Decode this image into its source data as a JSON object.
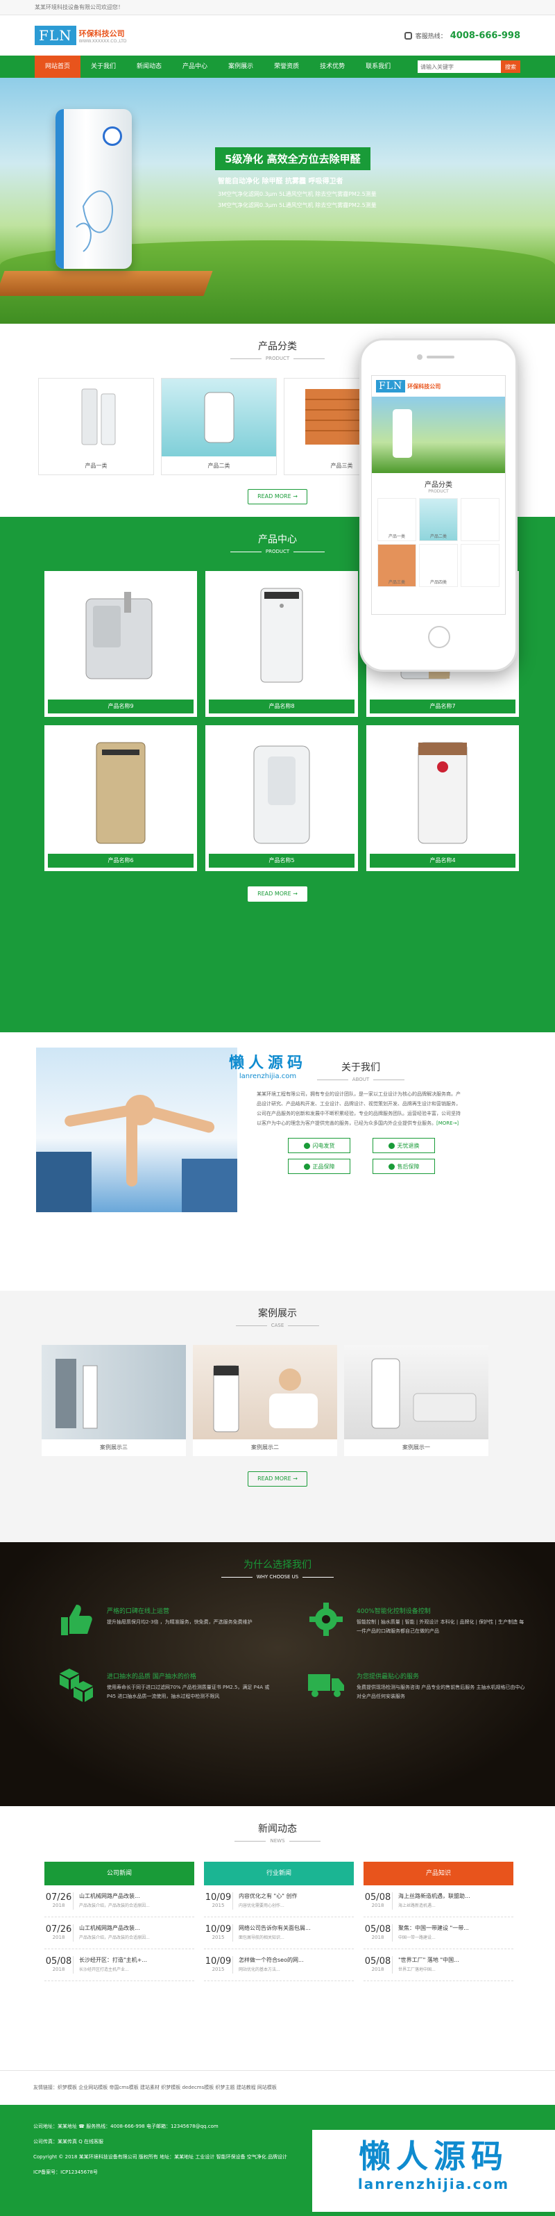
{
  "topbar": {
    "welcome": "某某环境科技设备有限公司欢迎您！"
  },
  "header": {
    "logo_mark": "FLN",
    "logo_cn": "环保科技公司",
    "logo_en": "WWW.XXXXXX.CO.,LTD",
    "hotline_label": "客服热线：",
    "hotline": "4008-666-998"
  },
  "nav": {
    "items": [
      "网站首页",
      "关于我们",
      "新闻动态",
      "产品中心",
      "案例展示",
      "荣誉资质",
      "技术优势",
      "联系我们"
    ],
    "search_placeholder": "请输入关键字",
    "search_button": "搜索"
  },
  "banner": {
    "title": "5级净化 高效全方位去除甲醛",
    "subtitle": "智能自动净化  除甲醛  抗雾霾  呼吸得卫者",
    "line1": "3M空气净化滤网0.3μm 5L通风空气机 除去空气雾霾PM2.5测量",
    "line2": "3M空气净化滤网0.3μm 5L通风空气机 除去空气雾霾PM2.5测量"
  },
  "category": {
    "title": "产品分类",
    "en": "PRODUCT",
    "items": [
      "产品一类",
      "产品二类",
      "产品三类"
    ],
    "more": "READ MORE →"
  },
  "products": {
    "title": "产品中心",
    "en": "PRODUCT",
    "items": [
      "产品名称9",
      "产品名称8",
      "产品名称7",
      "产品名称6",
      "产品名称5",
      "产品名称4"
    ],
    "more": "READ MORE →"
  },
  "phone": {
    "logo_mark": "FLN",
    "logo_cn": "环保科技公司",
    "title": "产品分类",
    "en": "PRODUCT",
    "items": [
      "产品一类",
      "产品二类",
      "产品三类",
      "产品四类"
    ]
  },
  "about": {
    "title": "关于我们",
    "en": "ABOUT",
    "text": "某某环境工程有限公司，拥有专业的设计团队，是一家以工业设计为核心的品牌解决服务商。产品设计研究、产品结构开发、工业设计、品牌设计、视觉策划开发、品牌再生设计和营销服务，公司在产品服务的创新和发展中不断积累经验，专业的品牌服务团队。运营经验丰富，公司坚持以客户为中心的理念为客户提供完善的服务，已经为众多国内外企业提供专业服务。",
    "more": "[MORE→]",
    "buttons": [
      "闪电发货",
      "无忧退换",
      "正品保障",
      "售后保障"
    ]
  },
  "watermark": {
    "cn": "懒人源码",
    "en": "lanrenzhijia.com"
  },
  "cases": {
    "title": "案例展示",
    "en": "CASE",
    "items": [
      "案例展示三",
      "案例展示二",
      "案例展示一"
    ],
    "more": "READ MORE →"
  },
  "why": {
    "title": "为什么选择我们",
    "en": "WHY CHOOSE US",
    "items": [
      {
        "title": "严格的口碑在线上运营",
        "desc": "提升抽屉质保月均2-3倍 ，为精准服务，快免费，严选服务免费维护"
      },
      {
        "title": "400%智能化控制设备控制",
        "desc": "智能控制 | 抽水质量 | 智能 | 外观设计 本科化 | 品牌化 | 保护性 | 生产制造 每一件产品的口碑服务都自己在做的产品"
      },
      {
        "title": "进口抽水的品质 国产抽水的价格",
        "desc": "使用寿命长于同于进口过滤网70% 产品检测质量证书 PM2.5，满足 P4A 或 P45 进口抽水品质一流使用，抽水过程中检测不限风"
      },
      {
        "title": "为您提供最贴心的服务",
        "desc": "免费提供现场检测与服务咨询 产品专业的售前售后服务 主抽水机规格已由中心对全产品任何安装服务"
      }
    ]
  },
  "news": {
    "title": "新闻动态",
    "en": "NEWS",
    "columns": [
      {
        "head": "公司新闻",
        "color": "#199b38",
        "items": [
          {
            "md": "07/26",
            "y": "2018",
            "t": "山工机械网路产品改装...",
            "d": "产品改装介绍，产品改装的合适原因..."
          },
          {
            "md": "07/26",
            "y": "2018",
            "t": "山工机械网路产品改装...",
            "d": "产品改装介绍，产品改装的合适原因..."
          },
          {
            "md": "05/08",
            "y": "2018",
            "t": "长沙经开区：打造\"主机+...",
            "d": "长沙经开区打造主机产业..."
          }
        ]
      },
      {
        "head": "行业新闻",
        "color": "#1bb593",
        "items": [
          {
            "md": "10/09",
            "y": "2015",
            "t": "内容优化之有 \"心\" 创作",
            "d": "内容优化需要用心创作..."
          },
          {
            "md": "10/09",
            "y": "2015",
            "t": "网络公司告诉你有关面包屑...",
            "d": "面包屑导航的相关知识..."
          },
          {
            "md": "10/09",
            "y": "2015",
            "t": "怎样做一个符合seo的网...",
            "d": "网站优化的基本方法..."
          }
        ]
      },
      {
        "head": "产品知识",
        "color": "#e8541c",
        "items": [
          {
            "md": "05/08",
            "y": "2018",
            "t": "海上丝路新造机遇，联盟助...",
            "d": "海上丝路新造机遇..."
          },
          {
            "md": "05/08",
            "y": "2018",
            "t": "聚焦：中国一带建设 \"一带...",
            "d": "中国一带一路建设..."
          },
          {
            "md": "05/08",
            "y": "2018",
            "t": "\"世界工厂\" 落地 \"中国...",
            "d": "世界工厂落地中国..."
          }
        ]
      }
    ]
  },
  "links": {
    "label": "友情链接：",
    "items": "织梦模板  企业网站模板  帝国cms模板  建站素材  织梦模板  dedecms模板  织梦主题  建站教程  网站模板"
  },
  "footer": {
    "line1": "公司地址：某某地址 ☎ 服务热线：4008-666-998  电子邮箱：12345678@qq.com",
    "line2": "公司传真：某某传真 Q 在线客服",
    "line3": "Copyright © 2018 某某环境科技设备有限公司 版权所有  地址：某某地址  工业设计 智能环保设备 空气净化 品牌设计",
    "line4": "ICP备案号：ICP12345678号"
  },
  "footer_watermark": {
    "cn": "懒人源码",
    "en": "lanrenzhijia.com"
  }
}
